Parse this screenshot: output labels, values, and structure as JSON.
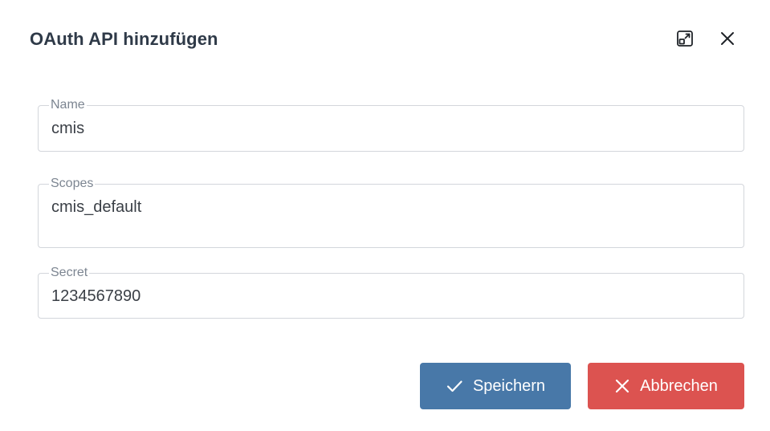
{
  "dialog": {
    "title": "OAuth API hinzufügen",
    "icons": {
      "expand": "expand-icon",
      "close": "close-icon"
    }
  },
  "form": {
    "name": {
      "label": "Name",
      "value": "cmis"
    },
    "scopes": {
      "label": "Scopes",
      "value": "cmis_default"
    },
    "secret": {
      "label": "Secret",
      "value": "1234567890"
    }
  },
  "actions": {
    "save_label": "Speichern",
    "save_icon": "check-icon",
    "cancel_label": "Abbrechen",
    "cancel_icon": "x-icon"
  },
  "colors": {
    "save": "#4878a8",
    "cancel": "#dc5350",
    "title": "#2f3a48",
    "border": "#d3d6db"
  }
}
